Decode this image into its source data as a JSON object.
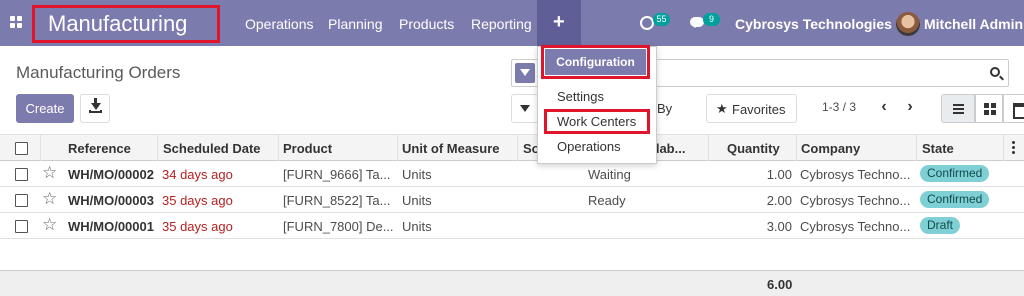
{
  "navbar": {
    "brand": "Manufacturing",
    "menu": [
      "Operations",
      "Planning",
      "Products",
      "Reporting"
    ],
    "plus": "+",
    "activity_count": "55",
    "messages_count": "9",
    "company": "Cybrosys Technologies",
    "user": "Mitchell Admin"
  },
  "dropdown": {
    "header": "Configuration",
    "items": [
      "Settings",
      "Work Centers",
      "Operations"
    ],
    "highlighted": "Work Centers"
  },
  "control_panel": {
    "title": "Manufacturing Orders",
    "create": "Create",
    "group_by": "By",
    "favorites": "Favorites",
    "pager": "1-3 / 3",
    "prev": "‹",
    "next": "›"
  },
  "table": {
    "columns": [
      "Reference",
      "Scheduled Date",
      "Product",
      "Unit of Measure",
      "So",
      "ailab...",
      "Quantity",
      "Company",
      "State"
    ],
    "rows": [
      {
        "reference": "WH/MO/00002",
        "scheduled": "34 days ago",
        "product": "[FURN_9666] Ta...",
        "uom": "Units",
        "availability": "Waiting",
        "quantity": "1.00",
        "company": "Cybrosys Techno...",
        "state": "Confirmed"
      },
      {
        "reference": "WH/MO/00003",
        "scheduled": "35 days ago",
        "product": "[FURN_8522] Ta...",
        "uom": "Units",
        "availability": "Ready",
        "quantity": "2.00",
        "company": "Cybrosys Techno...",
        "state": "Confirmed"
      },
      {
        "reference": "WH/MO/00001",
        "scheduled": "35 days ago",
        "product": "[FURN_7800] De...",
        "uom": "Units",
        "availability": "",
        "quantity": "3.00",
        "company": "Cybrosys Techno...",
        "state": "Draft"
      }
    ],
    "total_quantity": "6.00"
  },
  "colors": {
    "brand": "#7c7bad",
    "highlight_box": "#e0142a",
    "overdue": "#b52020",
    "state_pill": "#7fd0d5",
    "badge": "#00a09d"
  }
}
